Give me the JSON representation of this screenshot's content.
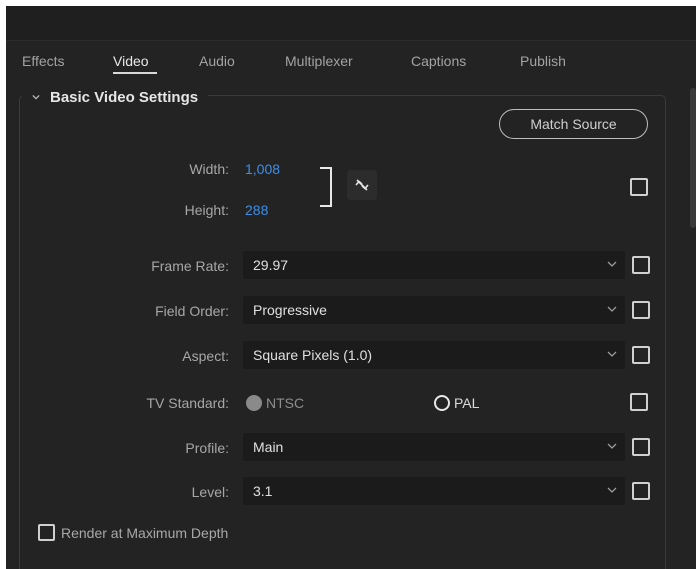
{
  "tabs": [
    {
      "label": "Effects",
      "active": false
    },
    {
      "label": "Video",
      "active": true
    },
    {
      "label": "Audio",
      "active": false
    },
    {
      "label": "Multiplexer",
      "active": false
    },
    {
      "label": "Captions",
      "active": false
    },
    {
      "label": "Publish",
      "active": false
    }
  ],
  "section": {
    "title": "Basic Video Settings",
    "match_source_label": "Match Source"
  },
  "dimensions": {
    "width_label": "Width:",
    "width_value": "1,008",
    "height_label": "Height:",
    "height_value": "288",
    "link_icon": "unlink-icon"
  },
  "frame_rate": {
    "label": "Frame Rate:",
    "value": "29.97"
  },
  "field_order": {
    "label": "Field Order:",
    "value": "Progressive"
  },
  "aspect": {
    "label": "Aspect:",
    "value": "Square Pixels (1.0)"
  },
  "tv_standard": {
    "label": "TV Standard:",
    "options": [
      "NTSC",
      "PAL"
    ],
    "selected": "NTSC"
  },
  "profile": {
    "label": "Profile:",
    "value": "Main"
  },
  "level": {
    "label": "Level:",
    "value": "3.1"
  },
  "render_max_depth": {
    "label": "Render at Maximum Depth",
    "checked": false
  },
  "colors": {
    "background": "#232323",
    "accent_blue": "#3d8ee6",
    "text_primary": "#e0e0e0",
    "text_secondary": "#a7a7a7",
    "dropdown_bg": "#1b1b1b"
  }
}
